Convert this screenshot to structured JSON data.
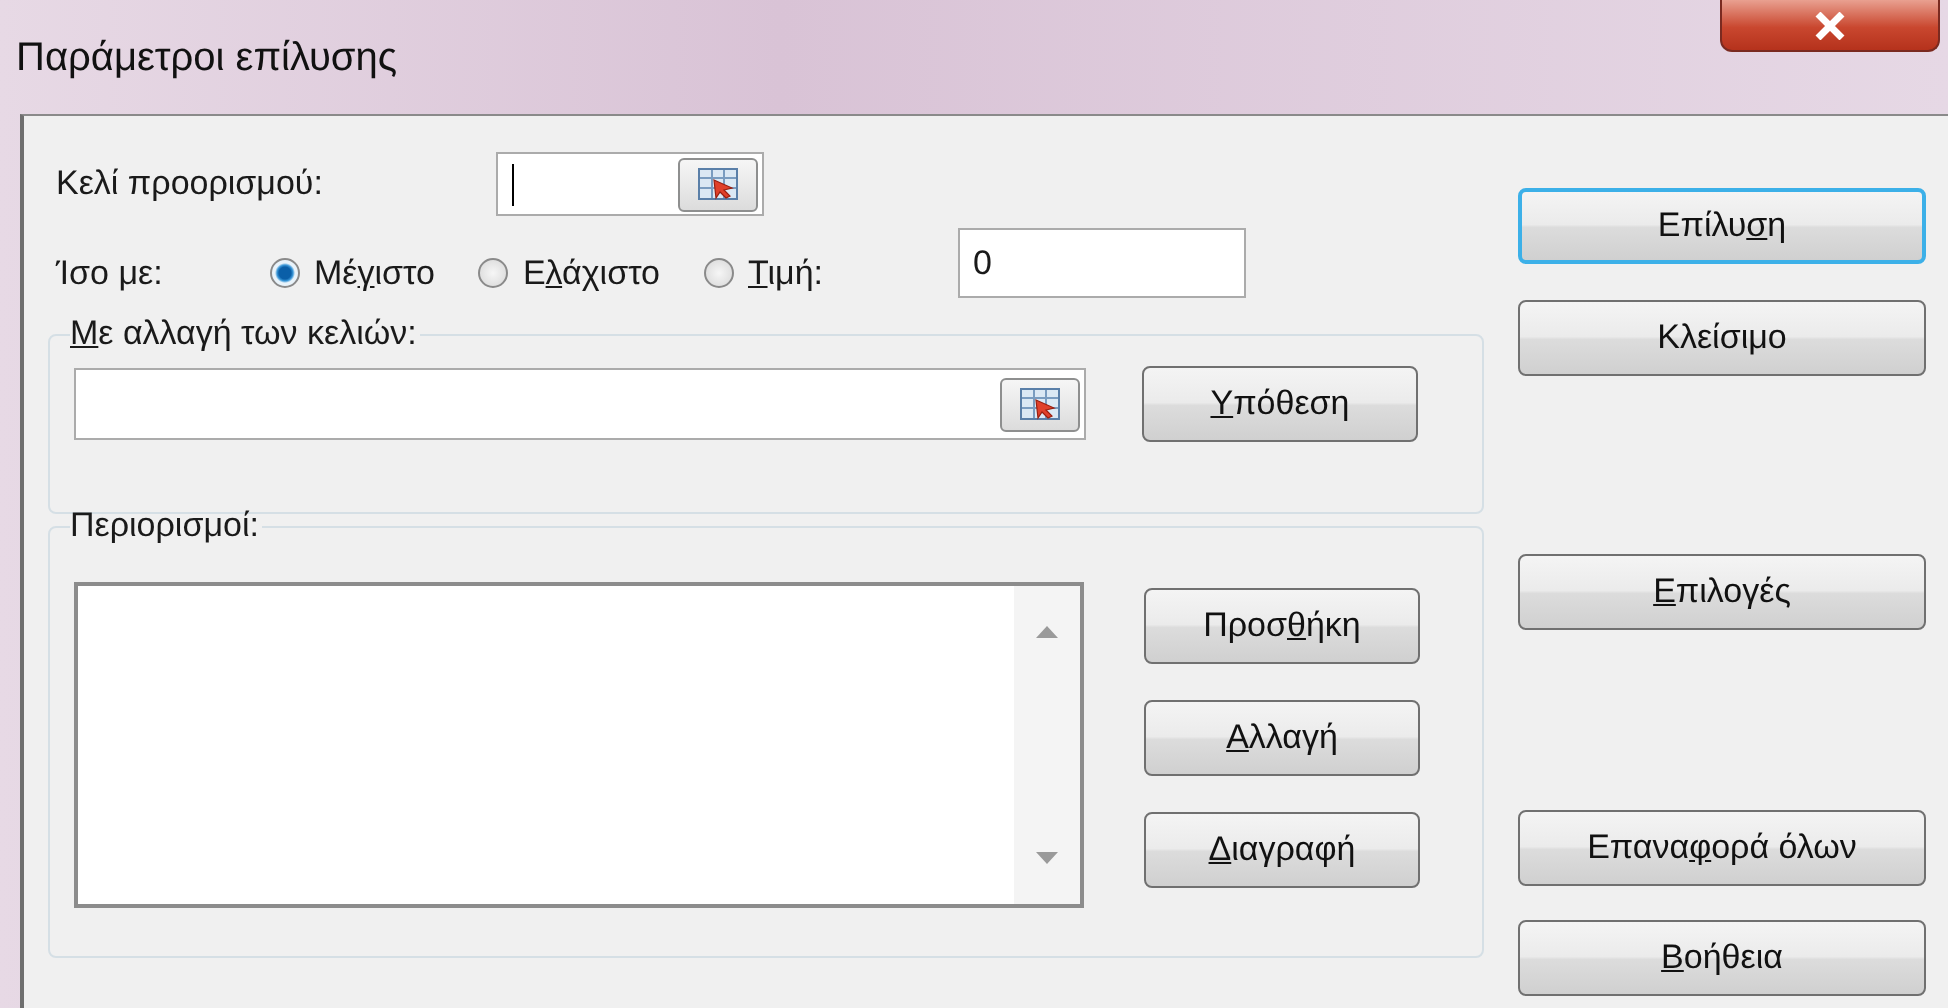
{
  "window": {
    "title": "Παράμετροι επίλυσης"
  },
  "target_cell": {
    "label": "Κελί προορισμού:",
    "focused": true
  },
  "equal_to": {
    "label": "Ίσο με:",
    "options": [
      {
        "label": {
          "before": "Μέ",
          "key": "γ",
          "after": "ιστο"
        },
        "selected": true
      },
      {
        "label": {
          "before": "Ε",
          "key": "λ",
          "after": "άχιστο"
        },
        "selected": false
      },
      {
        "label": {
          "key": "Τ",
          "after": "ιμή:"
        },
        "selected": false
      }
    ],
    "value": "0"
  },
  "changing_cells": {
    "label": {
      "key": "Μ",
      "after": "ε αλλαγή των κελιών:"
    },
    "button": {
      "label": {
        "key": "Υ",
        "after": "πόθεση"
      }
    }
  },
  "constraints": {
    "label": "Περιορισμοί:",
    "buttons": [
      {
        "label": {
          "before": "Προσ",
          "key": "θ",
          "after": "ήκη"
        }
      },
      {
        "label": {
          "key": "Α",
          "after": "λλαγή"
        }
      },
      {
        "label": {
          "key": "Δ",
          "after": "ιαγραφή"
        }
      }
    ]
  },
  "buttons": [
    {
      "label": {
        "before": "Επίλυ",
        "key": "σ",
        "after": "η"
      },
      "focused": true
    },
    {
      "label": {
        "before": "Κλείσιμο"
      },
      "focused": false
    },
    {
      "label": {
        "key": "Ε",
        "after": "πιλογές"
      },
      "focused": false
    },
    {
      "label": {
        "before": "Επανα",
        "key": "φ",
        "after": "ορά όλων"
      },
      "focused": false
    },
    {
      "label": {
        "key": "Β",
        "after": "οήθεια"
      },
      "focused": false
    }
  ]
}
